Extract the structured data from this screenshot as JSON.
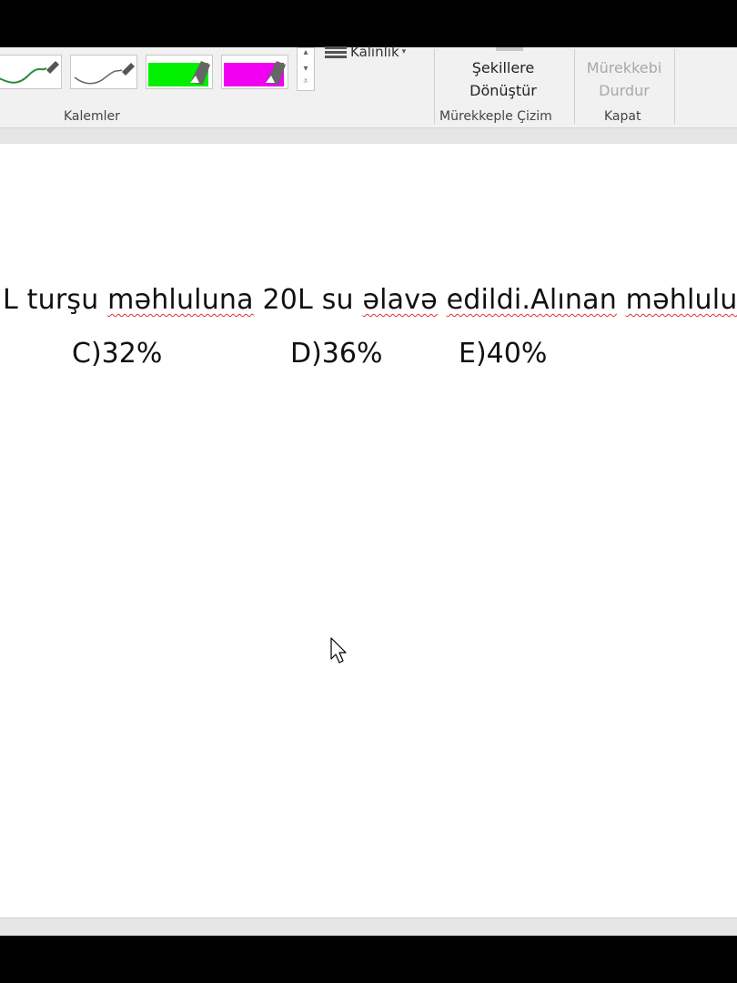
{
  "ribbon": {
    "pens_group_label": "Kalemler",
    "thickness_label": "Kalınlık",
    "convert_button": {
      "line1": "Şekillere",
      "line2": "Dönüştür"
    },
    "ink_group_label": "Mürekkeple Çizim",
    "stop_ink_button": {
      "line1": "Mürekkebi",
      "line2": "Durdur"
    },
    "close_group_label": "Kapat",
    "pens": [
      {
        "name": "green-pen",
        "color": "#2e8b3a"
      },
      {
        "name": "gray-pen",
        "color": "#555555"
      },
      {
        "name": "green-highlighter",
        "color": "#00f000"
      },
      {
        "name": "magenta-highlighter",
        "color": "#f000f0"
      }
    ]
  },
  "document": {
    "question_segments": {
      "s1": "L turşu ",
      "s2": "məhluluna",
      "s3": " 20L su ",
      "s4": "əlavə",
      "s5": " ",
      "s6": "edildi.Alınan",
      "s7": " ",
      "s8": "məhlulun"
    },
    "options": {
      "c": "C)32%",
      "d": "D)36%",
      "e": "E)40%"
    }
  }
}
